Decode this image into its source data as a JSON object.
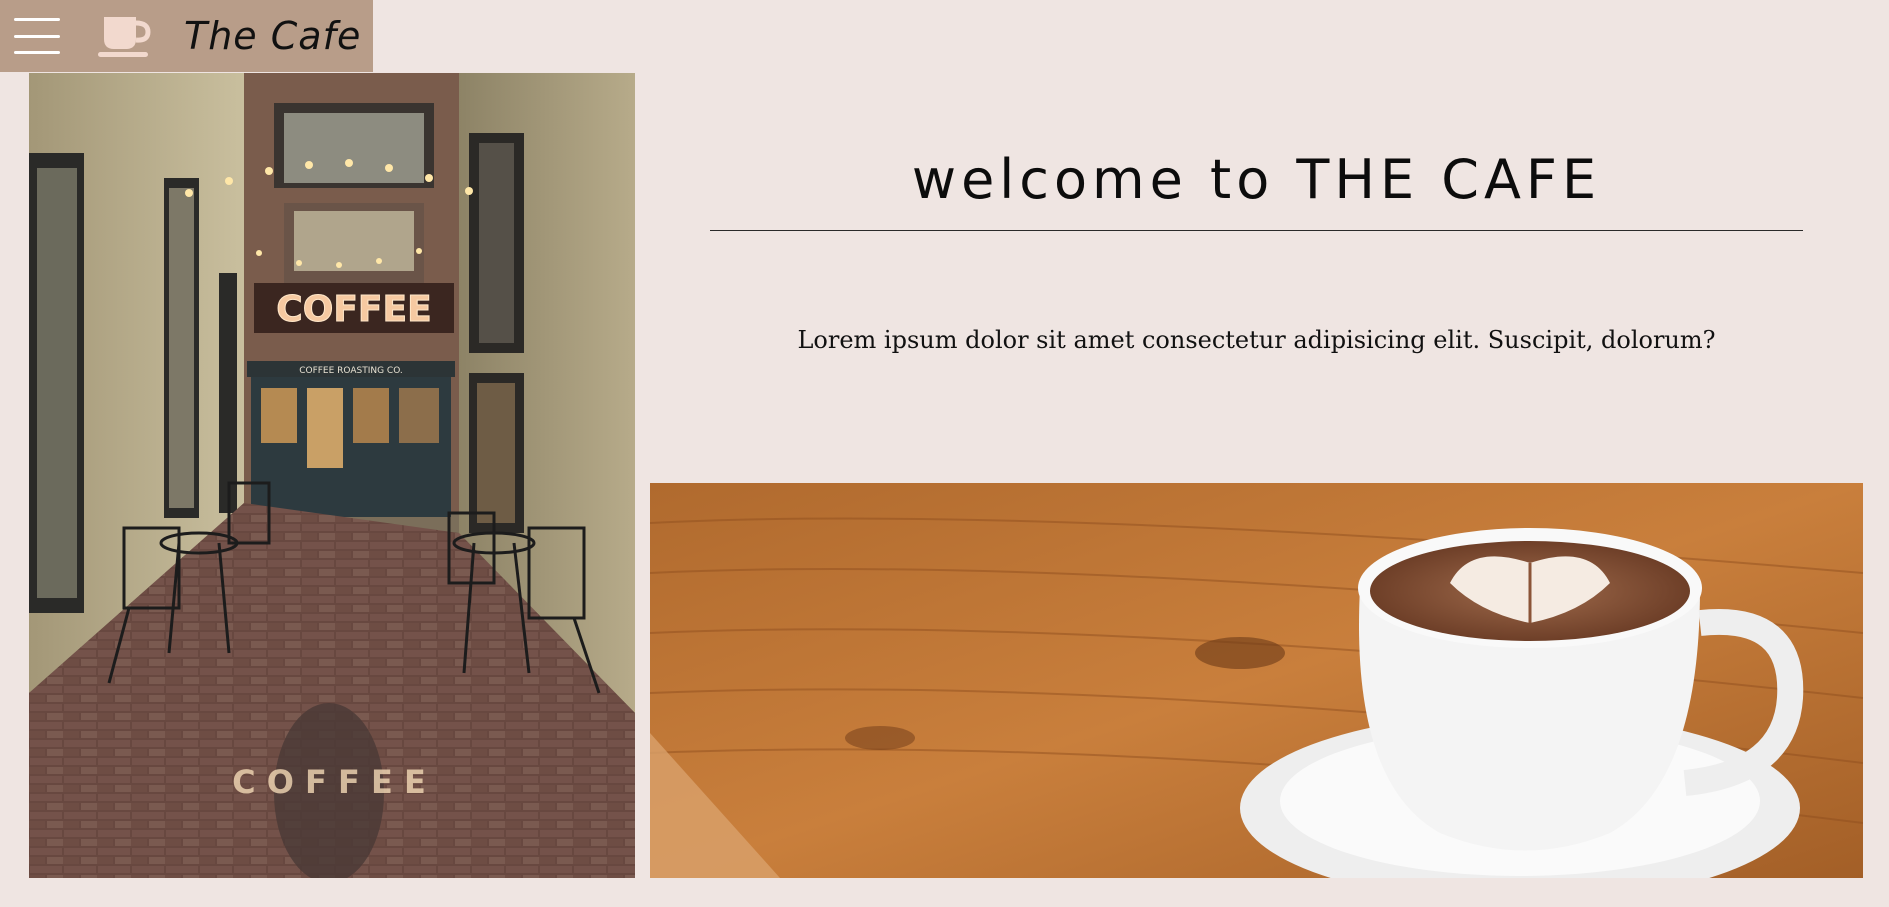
{
  "navbar": {
    "brand": "The Cafe",
    "menu_icon": "hamburger-menu-icon",
    "logo_icon": "coffee-cup-icon"
  },
  "hero": {
    "headline": "welcome to THE CAFE",
    "intro": "Lorem ipsum dolor sit amet consectetur adipisicing elit. Suscipit, dolorum?"
  },
  "images": {
    "left": {
      "sign_text": "COFFEE",
      "storefront_text": "COFFEE ROASTING CO."
    },
    "right": {}
  },
  "colors": {
    "background": "#efe5e2",
    "navbar": "#b89d89",
    "logo": "#f2d9ce"
  }
}
